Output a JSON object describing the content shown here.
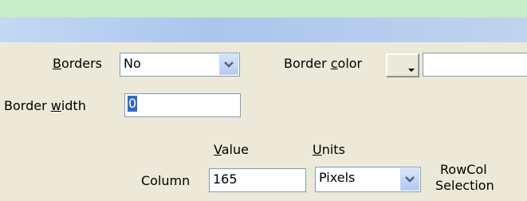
{
  "header": {},
  "borders": {
    "label": "Borders",
    "value": "No"
  },
  "border_color": {
    "label": "Border color",
    "value": ""
  },
  "border_width": {
    "label": "Border width",
    "value": "0"
  },
  "columns": {
    "value_header": "Value",
    "units_header": "Units"
  },
  "column_row": {
    "label": "Column",
    "value": "165",
    "units": "Pixels"
  },
  "rowcol_selection": {
    "line1": "RowCol",
    "line2": "Selection"
  },
  "icons": {
    "dropdown": "chevron-down-icon",
    "color_picker": "color-swatch-icon"
  }
}
